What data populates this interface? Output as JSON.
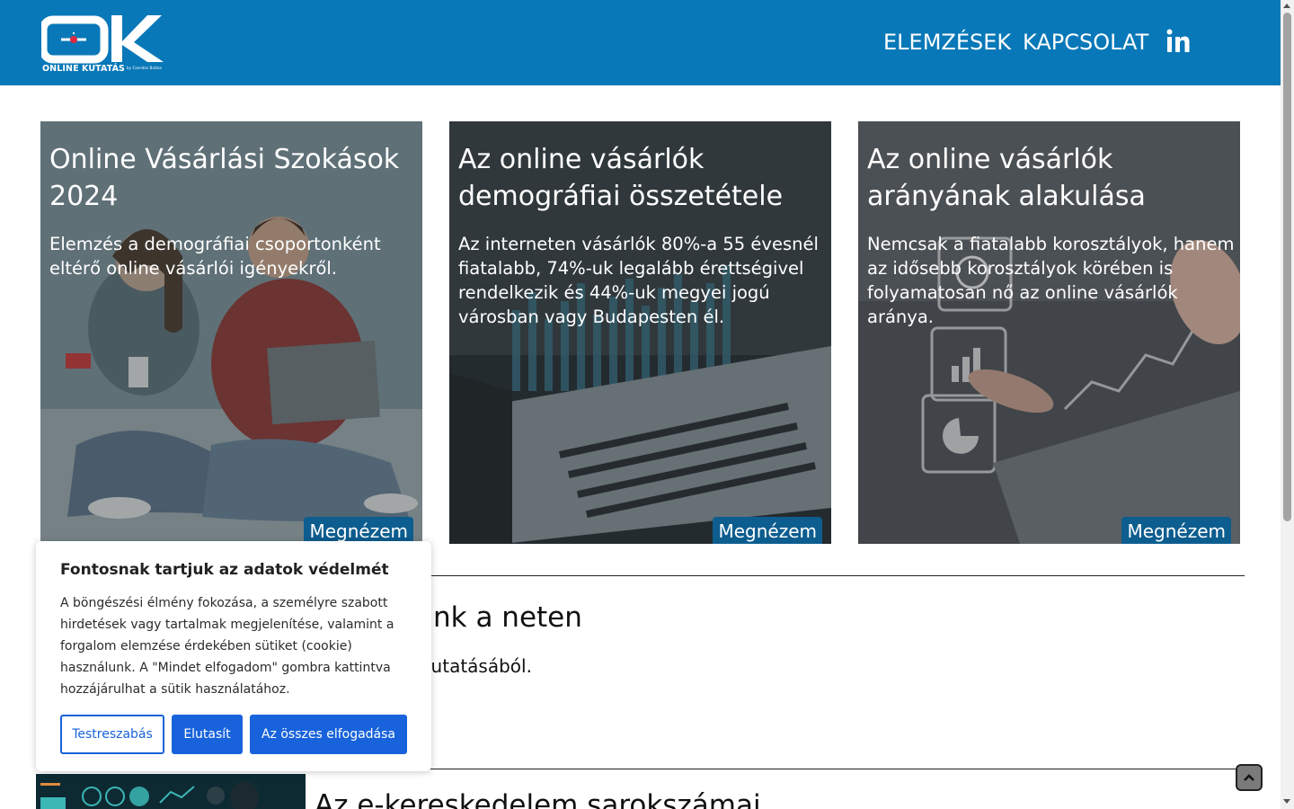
{
  "header": {
    "logo_letters": "OK",
    "logo_subtitle": "ONLINE KUTATÁS",
    "logo_byline": "by Csendes Balázs",
    "nav": [
      {
        "label": "ELEMZÉSEK"
      },
      {
        "label": "KAPCSOLAT"
      }
    ],
    "social_icon": "linkedin-icon"
  },
  "cards": [
    {
      "title": "Online Vásárlási Szokások 2024",
      "description": "Elemzés a demográfiai csoportonként eltérő online vásárlói igényekről.",
      "button": "Megnézem"
    },
    {
      "title": "Az online vásárlók demográfiai összetétele",
      "description": "Az interneten vásárlók 80%-a 55 évesnél fiatalabb, 74%-uk legalább érettségivel rendelkezik és 44%-uk megyei jogú városban vagy Budapesten él.",
      "button": "Megnézem"
    },
    {
      "title": "Az online vásárlók arányának alakulása",
      "description": "Nemcsak a fiatalabb korosztályok, hanem az idősebb korosztályok körében is folyamatosan nő az online vásárlók aránya.",
      "button": "Megnézem"
    }
  ],
  "section": {
    "title_visible": "bet költünk a neten",
    "desc_visible": "HH 2023-as kutatásából.",
    "next_title_visible": "Az e-kereskedelem sarokszámai"
  },
  "cookie": {
    "title": "Fontosnak tartjuk az adatok védelmét",
    "text": "A böngészési élmény fokozása, a személyre szabott hirdetések vagy tartalmak megjelenítése, valamint a forgalom elemzése érdekében sütiket (cookie) használunk. A \"Mindet elfogadom\" gombra kattintva hozzájárulhat a sütik használatához.",
    "buttons": {
      "customize": "Testreszabás",
      "reject": "Elutasít",
      "accept": "Az összes elfogadása"
    }
  },
  "colors": {
    "header_bg": "#0878b8",
    "button_bg": "#0d5d8f",
    "cookie_blue": "#1863dc"
  }
}
